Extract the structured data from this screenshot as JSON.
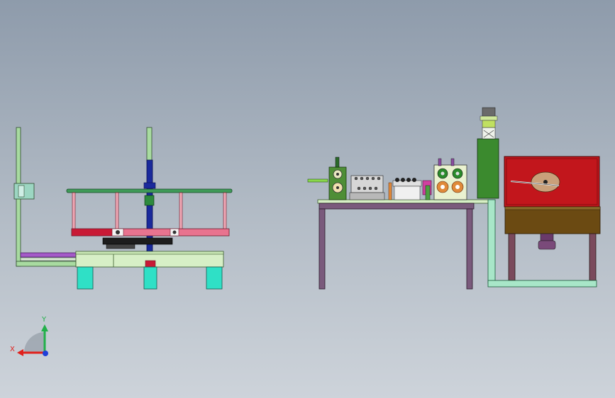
{
  "viewport": {
    "background_top": "#8e9bab",
    "background_bottom": "#cdd3da"
  },
  "triad": {
    "x_label": "X",
    "y_label": "Y",
    "x_color": "#e0201c",
    "y_color": "#22b04a",
    "z_color": "#1f3fd8"
  },
  "colors": {
    "frame_green": "#9fd39a",
    "table_purple": "#6b4d73",
    "pink": "#e8738f",
    "cyan": "#33e0c8",
    "blue_shaft": "#1a2a9c",
    "red_box": "#c2161c",
    "olive_panel": "#6b4a12",
    "dark_green": "#3b8a2e",
    "orange": "#e08a3a"
  }
}
